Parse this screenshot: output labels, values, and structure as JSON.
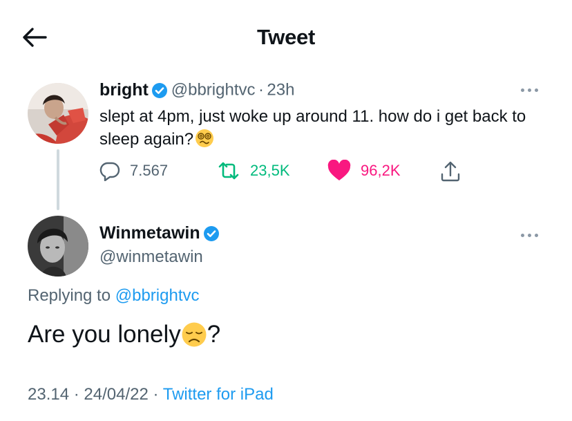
{
  "header": {
    "title": "Tweet",
    "back_icon": "arrow-left-icon"
  },
  "parent_tweet": {
    "name": "bright",
    "handle": "@bbrightvc",
    "separator": "·",
    "time": "23h",
    "text": "slept at 4pm, just woke up around 11. how do i get back to sleep again?",
    "emoji": "dizzy-face-emoji",
    "stats": {
      "replies": "7.567",
      "retweets": "23,5K",
      "likes": "96,2K"
    },
    "colors": {
      "retweet": "#00ba7c",
      "like": "#f91880"
    }
  },
  "reply_tweet": {
    "name": "Winmetawin",
    "handle": "@winmetawin",
    "replying_prefix": "Replying to",
    "replying_to": "@bbrightvc",
    "text": "Are you lonely",
    "emoji": "disappointed-face-emoji",
    "text_suffix": "?",
    "time": "23.14",
    "separator": "·",
    "date": "24/04/22",
    "separator2": "·",
    "source": "Twitter for iPad"
  },
  "colors": {
    "verified": "#1d9bf0",
    "link": "#1d9bf0",
    "secondary_text": "#536471"
  }
}
